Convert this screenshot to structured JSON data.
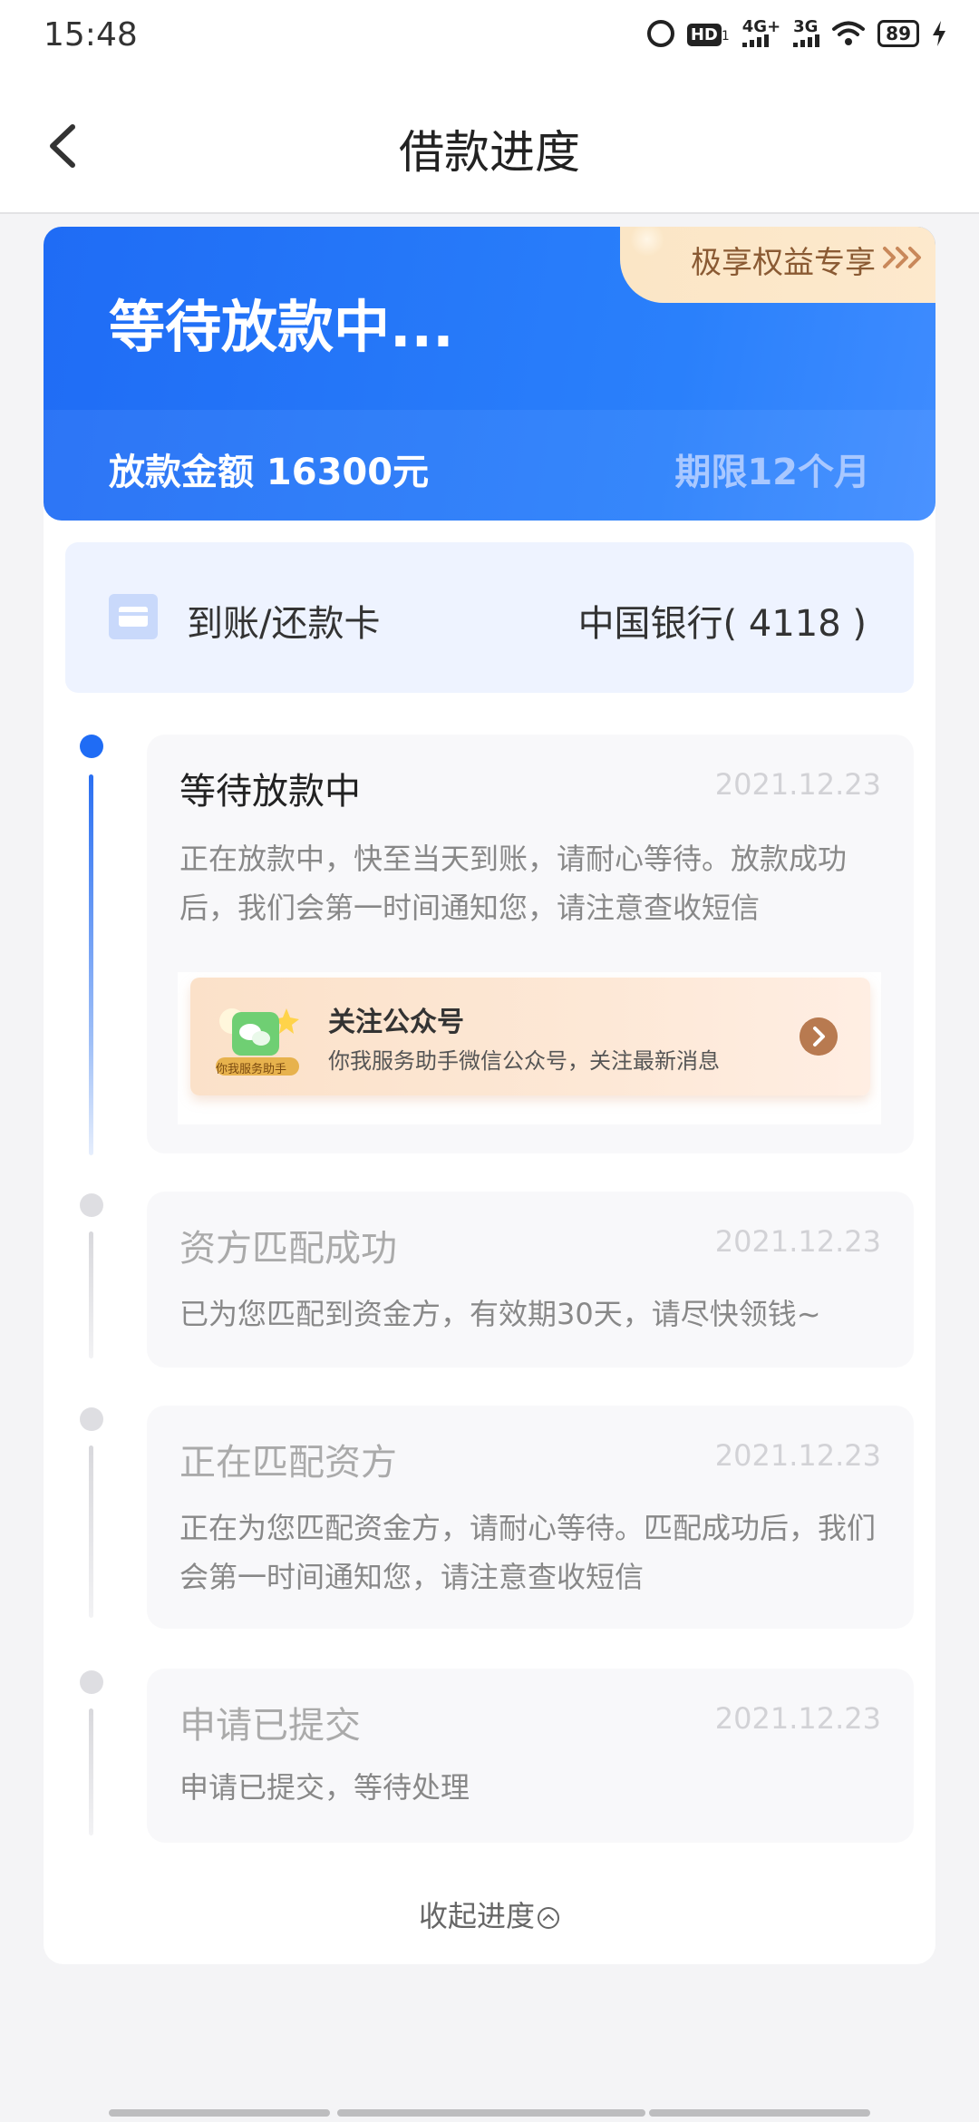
{
  "status_bar": {
    "time": "15:48",
    "hd": "HD",
    "hd_sub": "1",
    "net1": "4G+",
    "net2": "3G",
    "battery": "89"
  },
  "nav": {
    "title": "借款进度"
  },
  "summary": {
    "status": "等待放款中...",
    "amount": "放款金额 16300元",
    "term": "期限12个月",
    "promo": "极享权益专享"
  },
  "bank": {
    "label": "到账/还款卡",
    "value": "中国银行( 4118 )"
  },
  "steps": [
    {
      "title": "等待放款中",
      "date": "2021.12.23",
      "desc": "正在放款中，快至当天到账，请耐心等待。放款成功后，我们会第一时间通知您，请注意查收短信",
      "active": true
    },
    {
      "title": "资方匹配成功",
      "date": "2021.12.23",
      "desc": "已为您匹配到资金方，有效期30天，请尽快领钱~",
      "active": false
    },
    {
      "title": "正在匹配资方",
      "date": "2021.12.23",
      "desc": "正在为您匹配资金方，请耐心等待。匹配成功后，我们会第一时间通知您，请注意查收短信",
      "active": false
    },
    {
      "title": "申请已提交",
      "date": "2021.12.23",
      "desc": "申请已提交，等待处理",
      "active": false
    }
  ],
  "follow": {
    "title": "关注公众号",
    "desc": "你我服务助手微信公众号，关注最新消息",
    "badge": "你我服务助手"
  },
  "collapse_label": "收起进度",
  "colors": {
    "accent": "#1f6cf5",
    "promo_text": "#8a5a33",
    "inactive_dot": "#dedee2"
  },
  "icons": {
    "back": "chevron-left-icon",
    "card": "card-icon",
    "promo": "triple-chevron-right-icon",
    "follow_arrow": "chevron-right-circle-icon",
    "collapse": "chevron-up-circle-icon"
  }
}
